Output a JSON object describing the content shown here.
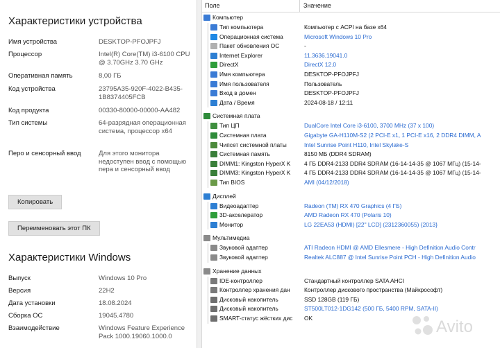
{
  "device": {
    "title": "Характеристики устройства",
    "specs": [
      {
        "label": "Имя устройства",
        "value": "DESKTOP-PFOJPFJ"
      },
      {
        "label": "Процессор",
        "value": "Intel(R) Core(TM) i3-6100 CPU @ 3.70GHz   3.70 GHz"
      },
      {
        "label": "Оперативная память",
        "value": "8,00 ГБ"
      },
      {
        "label": "Код устройства",
        "value": "23795A35-920F-4022-B435-1B8374405FCB"
      },
      {
        "label": "Код продукта",
        "value": "00330-80000-00000-AA482"
      },
      {
        "label": "Тип системы",
        "value": "64-разрядная операционная система, процессор x64"
      },
      {
        "label": "Перо и сенсорный ввод",
        "value": "Для этого монитора недоступен ввод с помощью пера и сенсорный ввод"
      }
    ],
    "copy_button": "Копировать",
    "rename_button": "Переименовать этот ПК"
  },
  "windows": {
    "title": "Характеристики Windows",
    "specs": [
      {
        "label": "Выпуск",
        "value": "Windows 10 Pro"
      },
      {
        "label": "Версия",
        "value": "22H2"
      },
      {
        "label": "Дата установки",
        "value": "18.08.2024"
      },
      {
        "label": "Сборка ОС",
        "value": "19045.4780"
      },
      {
        "label": "Взаимодействие",
        "value": "Windows Feature Experience Pack 1000.19060.1000.0"
      }
    ]
  },
  "aida": {
    "col_field": "Поле",
    "col_value": "Значение",
    "groups": [
      {
        "name": "Компьютер",
        "icon": "computer-icon",
        "color": "#3a7bd5",
        "rows": [
          {
            "field": "Тип компьютера",
            "value": "Компьютер с ACPI на базе x64",
            "link": false,
            "icon": "computer-icon",
            "color": "#3a7bd5"
          },
          {
            "field": "Операционная система",
            "value": "Microsoft Windows 10 Pro",
            "link": true,
            "icon": "windows-icon",
            "color": "#1e88e5"
          },
          {
            "field": "Пакет обновления ОС",
            "value": "-",
            "link": false,
            "icon": "page-icon",
            "color": "#b0b0b0"
          },
          {
            "field": "Internet Explorer",
            "value": "11.3636.19041.0",
            "link": true,
            "icon": "ie-icon",
            "color": "#2d7fd3"
          },
          {
            "field": "DirectX",
            "value": "DirectX 12.0",
            "link": true,
            "icon": "xbox-icon",
            "color": "#2e9d3a"
          },
          {
            "field": "Имя компьютера",
            "value": "DESKTOP-PFOJPFJ",
            "link": false,
            "icon": "computer-icon",
            "color": "#3a7bd5"
          },
          {
            "field": "Имя пользователя",
            "value": "Пользователь",
            "link": false,
            "icon": "computer-icon",
            "color": "#3a7bd5"
          },
          {
            "field": "Вход в домен",
            "value": "DESKTOP-PFOJPFJ",
            "link": false,
            "icon": "computer-icon",
            "color": "#3a7bd5"
          },
          {
            "field": "Дата / Время",
            "value": "2024-08-18 / 12:11",
            "link": false,
            "icon": "calendar-icon",
            "color": "#2d7fd3"
          }
        ]
      },
      {
        "name": "Системная плата",
        "icon": "motherboard-icon",
        "color": "#2e8b3a",
        "rows": [
          {
            "field": "Тип ЦП",
            "value": "DualCore Intel Core i3-6100, 3700 MHz (37 x 100)",
            "link": true,
            "icon": "cpu-icon",
            "color": "#3f8f3f"
          },
          {
            "field": "Системная плата",
            "value": "Gigabyte GA-H110M-S2  (2 PCI-E x1, 1 PCI-E x16, 2 DDR4 DIMM, A",
            "link": true,
            "icon": "motherboard-icon",
            "color": "#2e8b3a"
          },
          {
            "field": "Чипсет системной платы",
            "value": "Intel Sunrise Point H110, Intel Skylake-S",
            "link": true,
            "icon": "chip-icon",
            "color": "#4c8a3c"
          },
          {
            "field": "Системная память",
            "value": "8150 МБ  (DDR4 SDRAM)",
            "link": false,
            "icon": "memory-icon",
            "color": "#3a7f3a"
          },
          {
            "field": "DIMM1: Kingston HyperX K",
            "value": "4 ГБ DDR4-2133 DDR4 SDRAM  (16-14-14-35 @ 1067 МГц)  (15-14-",
            "link": false,
            "icon": "memory-icon",
            "color": "#3a7f3a"
          },
          {
            "field": "DIMM3: Kingston HyperX K",
            "value": "4 ГБ DDR4-2133 DDR4 SDRAM  (16-14-14-35 @ 1067 МГц)  (15-14-",
            "link": false,
            "icon": "memory-icon",
            "color": "#3a7f3a"
          },
          {
            "field": "Тип BIOS",
            "value": "AMI (04/12/2018)",
            "link": true,
            "icon": "bios-icon",
            "color": "#6b9a48"
          }
        ]
      },
      {
        "name": "Дисплей",
        "icon": "display-icon",
        "color": "#2d7fd3",
        "rows": [
          {
            "field": "Видеоадаптер",
            "value": "Radeon (TM) RX 470 Graphics  (4 ГБ)",
            "link": true,
            "icon": "display-icon",
            "color": "#2d7fd3"
          },
          {
            "field": "3D-акселератор",
            "value": "AMD Radeon RX 470 (Polaris 10)",
            "link": true,
            "icon": "xbox-icon",
            "color": "#2e9d3a"
          },
          {
            "field": "Монитор",
            "value": "LG 22EA53 (HDMI)  [22\" LCD]  (2312360055)  {2013}",
            "link": true,
            "icon": "monitor-icon",
            "color": "#2d7fd3"
          }
        ]
      },
      {
        "name": "Мультимедиа",
        "icon": "speaker-icon",
        "color": "#8a8a8a",
        "rows": [
          {
            "field": "Звуковой адаптер",
            "value": "ATI Radeon HDMI @ AMD Ellesmere - High Definition Audio Contr",
            "link": true,
            "icon": "speaker-icon",
            "color": "#8a8a8a"
          },
          {
            "field": "Звуковой адаптер",
            "value": "Realtek ALC887 @ Intel Sunrise Point PCH - High Definition Audio",
            "link": true,
            "icon": "speaker-icon",
            "color": "#8a8a8a"
          }
        ]
      },
      {
        "name": "Хранение данных",
        "icon": "storage-icon",
        "color": "#8a8a8a",
        "rows": [
          {
            "field": "IDE-контроллер",
            "value": "Стандартный контроллер SATA AHCI",
            "link": false,
            "icon": "controller-icon",
            "color": "#7a7a7a"
          },
          {
            "field": "Контроллер хранения дан",
            "value": "Контроллер дискового пространства (Майкрософт)",
            "link": false,
            "icon": "controller-icon",
            "color": "#7a7a7a"
          },
          {
            "field": "Дисковый накопитель",
            "value": "SSD 128GB  (119 ГБ)",
            "link": false,
            "icon": "disk-icon",
            "color": "#6f6f6f"
          },
          {
            "field": "Дисковый накопитель",
            "value": "ST500LT012-1DG142  (500 ГБ, 5400 RPM, SATA-II)",
            "link": true,
            "icon": "disk-icon",
            "color": "#6f6f6f"
          },
          {
            "field": "SMART-статус жёстких дис",
            "value": "OK",
            "link": false,
            "icon": "disk-icon",
            "color": "#6f6f6f"
          }
        ]
      }
    ]
  },
  "watermark": {
    "text": "Avito",
    "color": "#bdbdbd"
  }
}
